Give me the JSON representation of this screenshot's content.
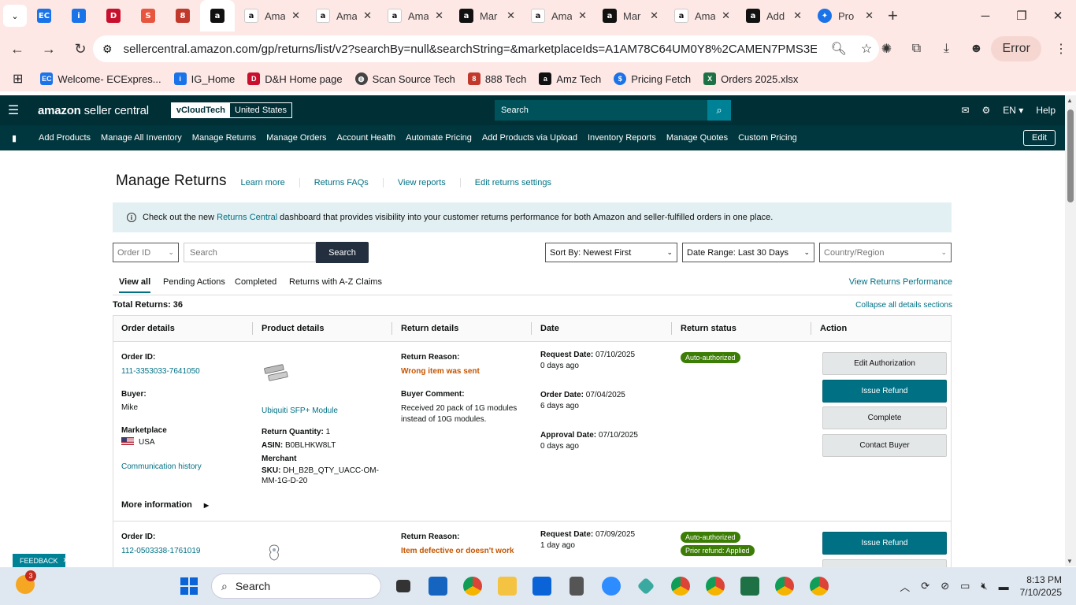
{
  "browser": {
    "tabs": [
      {
        "label": "Ama",
        "icon": "amazon-icon"
      },
      {
        "label": "Ama",
        "icon": "amazon-icon"
      },
      {
        "label": "Ama",
        "icon": "amazon-icon"
      },
      {
        "label": "Mar",
        "icon": "amazon-dark-icon"
      },
      {
        "label": "Ama",
        "icon": "amazon-icon"
      },
      {
        "label": "Mar",
        "icon": "amazon-dark-icon"
      },
      {
        "label": "Ama",
        "icon": "amazon-icon"
      },
      {
        "label": "Add",
        "icon": "amazon-dark-icon"
      },
      {
        "label": "Pro",
        "icon": "chrome-ext-icon"
      }
    ],
    "url": "sellercentral.amazon.com/gp/returns/list/v2?searchBy=null&searchString=&marketplaceIds=A1AM78C64UM0Y8%2CAMEN7PMS3EDWL%2C...",
    "error_label": "Error",
    "bookmarks": [
      {
        "label": "Welcome- ECExpres...",
        "color": "#1a73e8",
        "glyph": "EC"
      },
      {
        "label": "IG_Home",
        "color": "#1a73e8",
        "glyph": "i"
      },
      {
        "label": "D&H Home page",
        "color": "#c8102e",
        "glyph": "D"
      },
      {
        "label": "Scan Source Tech",
        "color": "#444444",
        "glyph": "S"
      },
      {
        "label": "888 Tech",
        "color": "#c0392b",
        "glyph": "8"
      },
      {
        "label": "Amz Tech",
        "color": "#111111",
        "glyph": "a"
      },
      {
        "label": "Pricing Fetch",
        "color": "#1a73e8",
        "glyph": "$"
      },
      {
        "label": "Orders 2025.xlsx",
        "color": "#1e7145",
        "glyph": "X"
      }
    ]
  },
  "header": {
    "logo_main": "amazon",
    "logo_sub": " seller central",
    "account_name": "vCloudTech",
    "account_region": "United States",
    "search_placeholder": "Search",
    "lang": "EN ▾",
    "help": "Help"
  },
  "nav": {
    "items": [
      "Add Products",
      "Manage All Inventory",
      "Manage Returns",
      "Manage Orders",
      "Account Health",
      "Automate Pricing",
      "Add Products via Upload",
      "Inventory Reports",
      "Manage Quotes",
      "Custom Pricing"
    ],
    "edit": "Edit"
  },
  "page": {
    "title": "Manage Returns",
    "links": [
      "Learn more",
      "Returns FAQs",
      "View reports",
      "Edit returns settings"
    ],
    "banner_pre": "Check out the new",
    "banner_link": "Returns Central",
    "banner_post": "dashboard that provides visibility into your customer returns performance for both Amazon and seller-fulfilled orders in one place.",
    "filter_order": "Order ID",
    "search_placeholder": "Search",
    "search_button": "Search",
    "sort": "Sort By: Newest First",
    "date_range": "Date Range: Last 30 Days",
    "country": "Country/Region",
    "tabs": [
      "View all",
      "Pending Actions",
      "Completed",
      "Returns with A-Z Claims"
    ],
    "view_performance": "View Returns Performance",
    "total": "Total Returns: 36",
    "collapse": "Collapse all details sections",
    "columns": [
      "Order details",
      "Product details",
      "Return details",
      "Date",
      "Return status",
      "Action"
    ]
  },
  "rows": [
    {
      "order_label": "Order ID:",
      "order_id": "111-3353033-7641050",
      "buyer_label": "Buyer:",
      "buyer": "Mike",
      "marketplace_label": "Marketplace",
      "marketplace": "USA",
      "comm": "Communication history",
      "more": "More information",
      "product": "Ubiquiti SFP+ Module",
      "qty_label": "Return Quantity:",
      "qty": "1",
      "asin_label": "ASIN:",
      "asin": "B0BLHKW8LT",
      "merchant_label": "Merchant",
      "sku_label": "SKU:",
      "sku": "DH_B2B_QTY_UACC-OM-MM-1G-D-20",
      "reason_label": "Return Reason:",
      "reason": "Wrong item was sent",
      "comment_label": "Buyer Comment:",
      "comment": "Received 20 pack of 1G modules instead of 10G modules.",
      "req_label": "Request Date:",
      "req_date": "07/10/2025",
      "req_ago": "0 days ago",
      "ord_label": "Order Date:",
      "ord_date": "07/04/2025",
      "ord_ago": "6 days ago",
      "app_label": "Approval Date:",
      "app_date": "07/10/2025",
      "app_ago": "0 days ago",
      "status": "Auto-authorized",
      "actions": [
        "Edit Authorization",
        "Issue Refund",
        "Complete",
        "Contact Buyer"
      ]
    },
    {
      "order_label": "Order ID:",
      "order_id": "112-0503338-1761019",
      "reason_label": "Return Reason:",
      "reason": "Item defective or doesn't work",
      "req_label": "Request Date:",
      "req_date": "07/09/2025",
      "req_ago": "1 day ago",
      "status": "Auto-authorized",
      "status2": "Prior refund: Applied",
      "actions": [
        "Issue Refund"
      ]
    }
  ],
  "feedback": "FEEDBACK",
  "taskbar": {
    "weather_badge": "3",
    "search": "Search",
    "time": "8:13 PM",
    "date": "7/10/2025"
  }
}
